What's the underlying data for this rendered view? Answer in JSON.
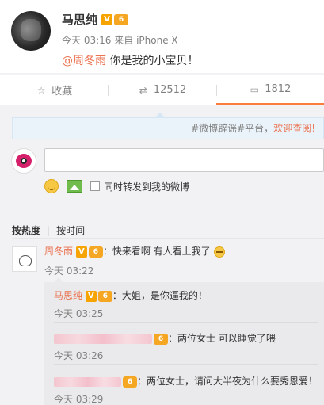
{
  "post": {
    "author": "马思纯",
    "v_badge": "V",
    "level_badge": "6",
    "time": "今天 03:16",
    "source_prefix": "来自",
    "source": "iPhone X",
    "mention": "@周冬雨",
    "text": " 你是我的小宝贝！"
  },
  "actions": {
    "favorite_label": "收藏",
    "repost_count": "12512",
    "comment_count": "1812"
  },
  "icons": {
    "favorite": "star-icon",
    "repost": "repost-icon",
    "comment": "comment-icon"
  },
  "notice": {
    "text": "#微博辟谣#平台，",
    "link": "欢迎查阅!"
  },
  "composer": {
    "repost_checkbox_label": "同时转发到我的微博"
  },
  "sort": {
    "hot": "按热度",
    "time": "按时间"
  },
  "comment": {
    "author": "周冬雨",
    "text": "：快来看啊 有人看上我了",
    "time": "今天 03:22"
  },
  "replies": [
    {
      "author": "马思纯",
      "text": "：大姐，是你逼我的！",
      "time": "今天 03:25"
    },
    {
      "author": "",
      "text": "：两位女士 可以睡觉了喂",
      "time": "今天 03:26"
    },
    {
      "author": "",
      "text": "：两位女士，请问大半夜为什么要秀恩爱！",
      "time": "今天 03:29"
    }
  ],
  "colors": {
    "accent": "#eb7350",
    "badge": "#f7a400",
    "notice_bg": "#eaf3fa"
  }
}
